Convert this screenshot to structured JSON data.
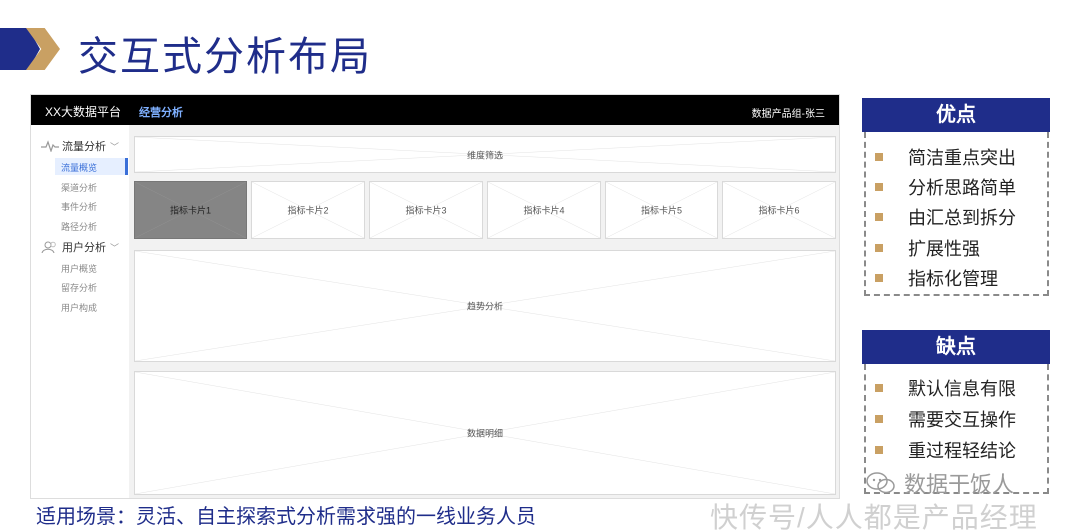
{
  "slide": {
    "title": "交互式分析布局",
    "scenario": "适用场景：灵活、自主探索式分析需求强的一线业务人员",
    "watermark": "快传号/人人都是产品经理",
    "wechat_brand": "数据干饭人"
  },
  "mockup": {
    "brand": "XX大数据平台",
    "nav_tab": "经营分析",
    "user": "数据产品组-张三",
    "sidebar": {
      "group1_label": "流量分析",
      "group1_items": [
        "流量概览",
        "渠道分析",
        "事件分析",
        "路径分析"
      ],
      "group2_label": "用户分析",
      "group2_items": [
        "用户概览",
        "留存分析",
        "用户构成"
      ]
    },
    "filter_label": "维度筛选",
    "cards": [
      "指标卡片1",
      "指标卡片2",
      "指标卡片3",
      "指标卡片4",
      "指标卡片5",
      "指标卡片6"
    ],
    "trend_label": "趋势分析",
    "detail_label": "数据明细"
  },
  "pros": {
    "title": "优点",
    "items": [
      "简洁重点突出",
      "分析思路简单",
      "由汇总到拆分",
      "扩展性强",
      "指标化管理"
    ]
  },
  "cons": {
    "title": "缺点",
    "items": [
      "默认信息有限",
      "需要交互操作",
      "重过程轻结论"
    ]
  },
  "colors": {
    "primary": "#1f2d8a",
    "accent": "#c9a063",
    "link": "#3a6fd8"
  },
  "icons": {
    "header": "chevron-arrow-icon",
    "traffic": "pulse-line-icon",
    "users": "users-icon",
    "wechat": "wechat-icon"
  }
}
